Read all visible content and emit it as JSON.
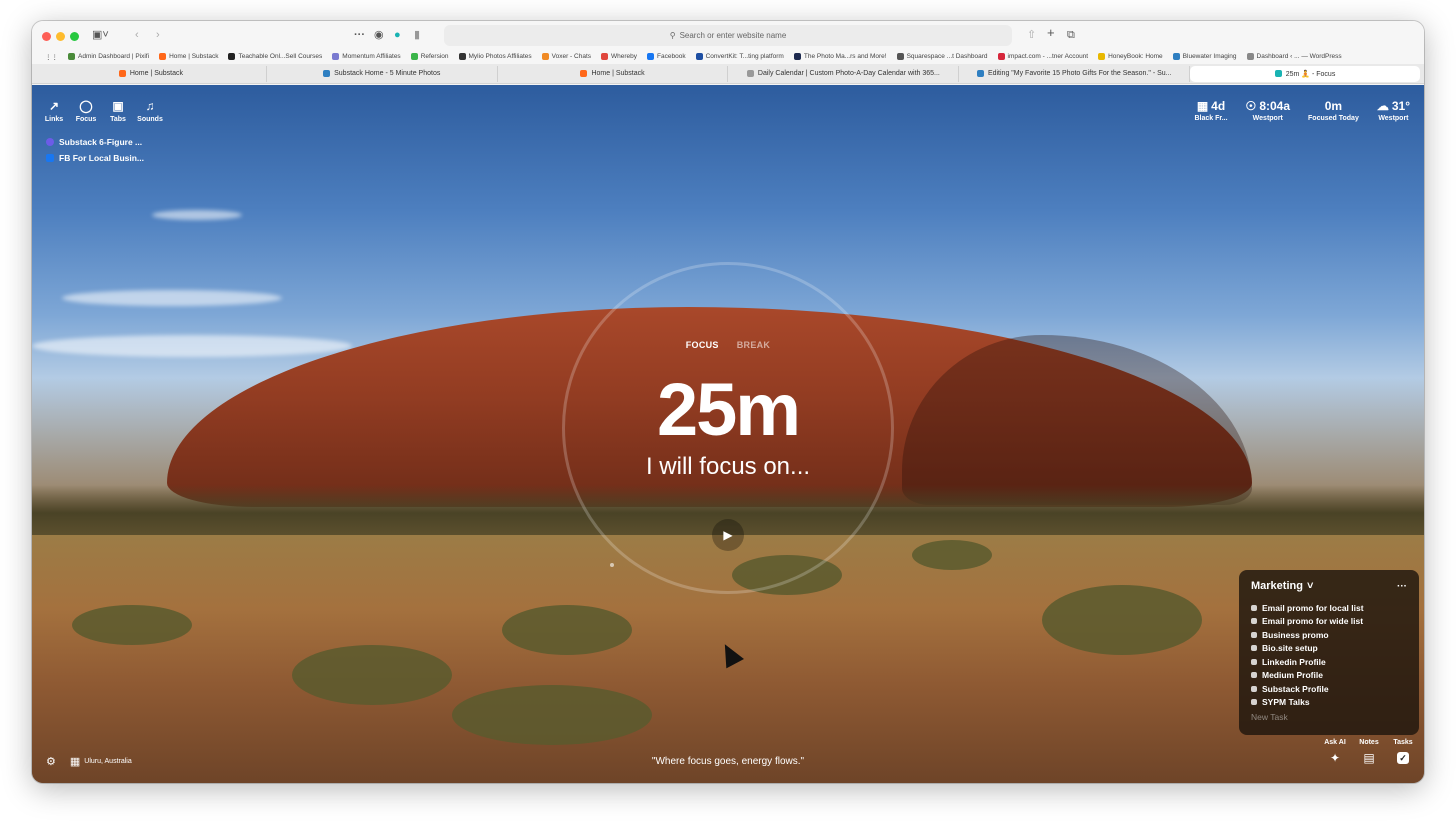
{
  "browser": {
    "url_placeholder": "Search or enter website name",
    "bookmarks": [
      {
        "label": "Admin Dashboard | Pixifi",
        "color": "#4a8b3a"
      },
      {
        "label": "Home | Substack",
        "color": "#ff6719"
      },
      {
        "label": "Teachable Onl...Sell Courses",
        "color": "#222222"
      },
      {
        "label": "Momentum Affiliates",
        "color": "#7a7ad0"
      },
      {
        "label": "Refersion",
        "color": "#3bb54a"
      },
      {
        "label": "Mylio Photos Affiliates",
        "color": "#333333"
      },
      {
        "label": "Voxer - Chats",
        "color": "#f08a24"
      },
      {
        "label": "Whereby",
        "color": "#e0463d"
      },
      {
        "label": "Facebook",
        "color": "#1877f2"
      },
      {
        "label": "ConvertKit: T...ting platform",
        "color": "#1e4fa3"
      },
      {
        "label": "The Photo Ma...rs and More!",
        "color": "#1d2a4f"
      },
      {
        "label": "Squarespace ...t Dashboard",
        "color": "#555555"
      },
      {
        "label": "impact.com - ...tner Account",
        "color": "#d6263b"
      },
      {
        "label": "HoneyBook: Home",
        "color": "#e8b800"
      },
      {
        "label": "Bluewater Imaging",
        "color": "#2f7fc1"
      },
      {
        "label": "Dashboard ‹ ... — WordPress",
        "color": "#888888"
      }
    ],
    "tabs": [
      {
        "label": "Home | Substack",
        "color": "#ff6719",
        "active": false
      },
      {
        "label": "Substack Home - 5 Minute Photos",
        "color": "#2f7fc1",
        "active": false
      },
      {
        "label": "Home | Substack",
        "color": "#ff6719",
        "active": false
      },
      {
        "label": "Daily Calendar | Custom Photo-A-Day Calendar with 365...",
        "color": "#999999",
        "active": false
      },
      {
        "label": "Editing \"My Favorite 15 Photo Gifts For the Season.\" - Su...",
        "color": "#2f7fc1",
        "active": false
      },
      {
        "label": "25m 🧘 - Focus",
        "color": "#19b3b3",
        "active": true
      }
    ]
  },
  "nav": {
    "links_label": "Links",
    "focus_label": "Focus",
    "tabs_label": "Tabs",
    "sounds_label": "Sounds"
  },
  "links": [
    {
      "label": "Substack 6-Figure ...",
      "color": "#6c5ce7"
    },
    {
      "label": "FB For Local Busin...",
      "color": "#1877f2"
    }
  ],
  "stats": {
    "countdown": {
      "value": "4d",
      "label": "Black Fr..."
    },
    "clock": {
      "value": "8:04a",
      "label": "Westport"
    },
    "focused": {
      "value": "0m",
      "label": "Focused Today"
    },
    "weather": {
      "value": "31°",
      "label": "Westport"
    }
  },
  "focus": {
    "mode_focus": "FOCUS",
    "mode_break": "BREAK",
    "timer": "25m",
    "intent": "I will focus on..."
  },
  "tasks": {
    "title": "Marketing",
    "items": [
      "Email promo for local list",
      "Email promo for wide list",
      "Business promo",
      "Bio.site setup",
      "Linkedin Profile",
      "Medium Profile",
      "Substack Profile",
      "SYPM Talks"
    ],
    "new_task_placeholder": "New Task"
  },
  "footer": {
    "location": "Uluru, Australia",
    "quote": "\"Where focus goes, energy flows.\"",
    "ask_ai": "Ask AI",
    "notes": "Notes",
    "tasks": "Tasks"
  }
}
